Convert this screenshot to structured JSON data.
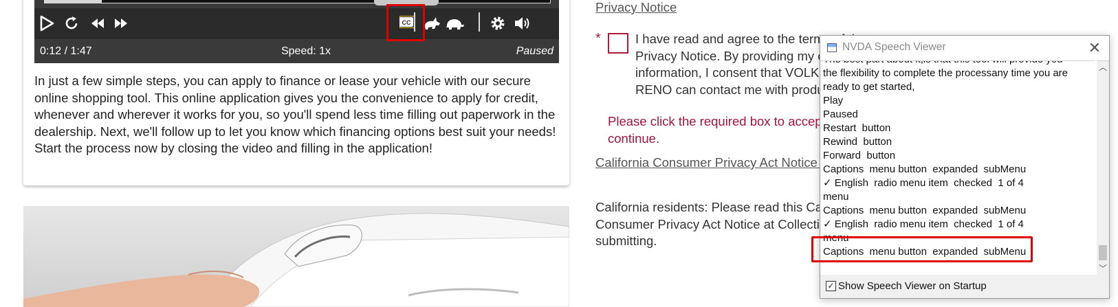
{
  "video_player": {
    "time_display": "0:12 / 1:47",
    "speed_display": "Speed: 1x",
    "state_display": "Paused",
    "progress_fraction": 0.113,
    "controls": [
      "play-icon",
      "restart-icon",
      "rewind-icon",
      "forward-icon",
      "captions-icon",
      "rabbit-speed-icon",
      "turtle-speed-icon",
      "settings-gear-icon",
      "volume-icon"
    ],
    "cc_label": "CC"
  },
  "intro_text": "In just a few simple steps, you can apply to finance or lease your vehicle with our secure online shopping tool. This online application gives you the convenience to apply for credit, whenever and wherever it works for you, so you'll spend less time filling out paperwork in the dealership. Next, we'll follow up to let you know which financing options best suit your needs! Start the process now by closing the video and filling in the application!",
  "form": {
    "privacy_link": "Privacy Notice",
    "required_star": "*",
    "agree_text": "I have read and agree to the terms of the Privacy Notice. By providing my contact information, I consent that VOLKSWAGEN OF RENO can contact me with product information.",
    "error_text": "Please click the required box to accept and continue.",
    "ccpa_link": "California Consumer Privacy Act Notice at Collection",
    "ca_residents_text": "California residents: Please read this California Consumer Privacy Act Notice at Collection before submitting."
  },
  "nvda_viewer": {
    "title": "NVDA Speech Viewer",
    "lines": [
      "The best part about it,is that this tool will provide you",
      "the flexibility to complete the processany time you are",
      "ready to get started,",
      "Play",
      "Paused",
      "Restart  button",
      "Rewind  button",
      "Forward  button",
      "Captions  menu button  expanded  subMenu",
      "✓ English  radio menu item  checked  1 of 4",
      "menu",
      "Captions  menu button  expanded  subMenu",
      "✓ English  radio menu item  checked  1 of 4",
      "menu",
      "Captions  menu button  expanded  subMenu"
    ],
    "show_on_startup_label": "Show Speech Viewer on Startup",
    "show_on_startup_checked": true
  },
  "colors": {
    "annotation_red": "#e00000",
    "required_red": "#b01a3a",
    "error_text": "#a5123e",
    "player_bg": "#2b2b2b"
  }
}
